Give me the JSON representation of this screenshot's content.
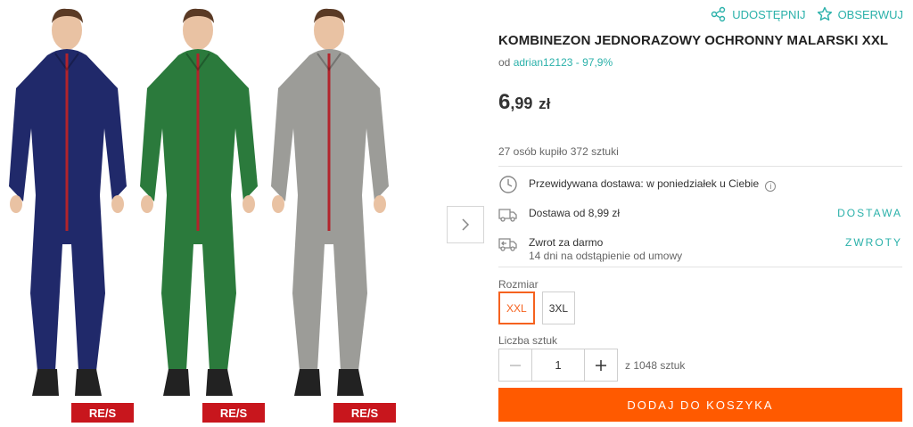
{
  "product": {
    "title": "KOMBINEZON JEDNORAZOWY OCHRONNY MALARSKI XXL",
    "seller_prefix": "od",
    "seller": "adrian12123 - 97,9%",
    "price_int": "6",
    "price_dec": ",99",
    "price_currency": "zł",
    "bought": "27 osób kupiło 372 sztuki"
  },
  "actions": {
    "share": "UDOSTĘPNIJ",
    "watch": "OBSERWUJ"
  },
  "gallery": {
    "brand_label": "RE/S",
    "colors": [
      "#20296a",
      "#2b7a3c",
      "#9c9c98"
    ]
  },
  "delivery": {
    "estimate": "Przewidywana dostawa: w poniedziałek u Ciebie",
    "shipping": "Dostawa od 8,99 zł",
    "shipping_link": "DOSTAWA",
    "returns": "Zwrot za darmo",
    "returns_sub": "14 dni na odstąpienie od umowy",
    "returns_link": "ZWROTY"
  },
  "size": {
    "label": "Rozmiar",
    "options": [
      "XXL",
      "3XL"
    ],
    "selected": "XXL"
  },
  "quantity": {
    "label": "Liczba sztuk",
    "value": "1",
    "stock": "z 1048 sztuk"
  },
  "cart": {
    "button": "DODAJ DO KOSZYKA"
  },
  "colors": {
    "accent": "#2bb1aa",
    "cta": "#ff5a00",
    "selected": "#f5621f"
  }
}
